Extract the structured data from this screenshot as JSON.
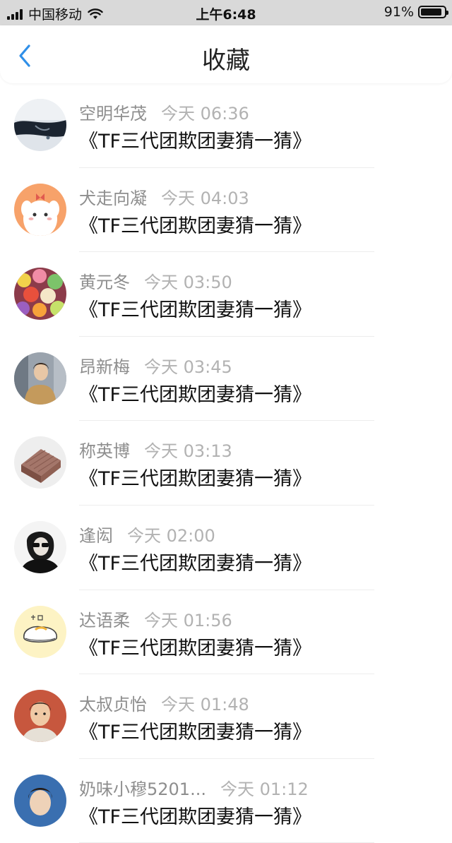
{
  "status_bar": {
    "carrier": "中国移动",
    "time": "上午6:48",
    "battery": "91%",
    "battery_level": 0.91
  },
  "nav": {
    "title": "收藏",
    "back_icon": "chevron-left-icon"
  },
  "items": [
    {
      "name": "空明华茂",
      "time": "今天 06:36",
      "content": "《TF三代团欺团妻猜一猜》"
    },
    {
      "name": "犬走向凝",
      "time": "今天 04:03",
      "content": "《TF三代团欺团妻猜一猜》"
    },
    {
      "name": "黄元冬",
      "time": "今天 03:50",
      "content": "《TF三代团欺团妻猜一猜》"
    },
    {
      "name": "昂新梅",
      "time": "今天 03:45",
      "content": "《TF三代团欺团妻猜一猜》"
    },
    {
      "name": "称英博",
      "time": "今天 03:13",
      "content": "《TF三代团欺团妻猜一猜》"
    },
    {
      "name": "逢闳",
      "time": "今天 02:00",
      "content": "《TF三代团欺团妻猜一猜》"
    },
    {
      "name": "达语柔",
      "time": "今天 01:56",
      "content": "《TF三代团欺团妻猜一猜》"
    },
    {
      "name": "太叔贞怡",
      "time": "今天 01:48",
      "content": "《TF三代团欺团妻猜一猜》"
    },
    {
      "name": "奶味小穆5201...",
      "time": "今天 01:12",
      "content": "《TF三代团欺团妻猜一猜》"
    }
  ]
}
